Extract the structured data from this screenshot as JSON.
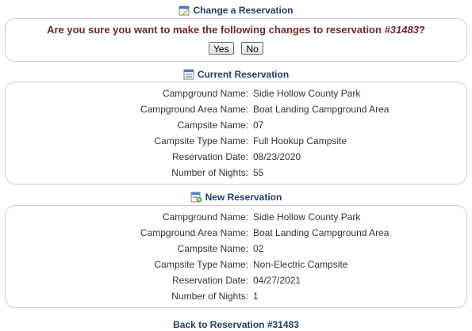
{
  "change": {
    "title": "Change a Reservation",
    "question_prefix": "Are you sure you want to make the following changes to reservation ",
    "reservation_number": "#31483",
    "question_suffix": "?",
    "yes_label": "Yes",
    "no_label": "No"
  },
  "current": {
    "title": "Current Reservation",
    "fields": [
      {
        "label": "Campground Name:",
        "value": "Sidie Hollow County Park"
      },
      {
        "label": "Campground Area Name:",
        "value": "Boat Landing Campground Area"
      },
      {
        "label": "Campsite Name:",
        "value": "07"
      },
      {
        "label": "Campsite Type Name:",
        "value": "Full Hookup Campsite"
      },
      {
        "label": "Reservation Date:",
        "value": "08/23/2020"
      },
      {
        "label": "Number of Nights:",
        "value": "55"
      }
    ]
  },
  "new": {
    "title": "New Reservation",
    "fields": [
      {
        "label": "Campground Name:",
        "value": "Sidie Hollow County Park"
      },
      {
        "label": "Campground Area Name:",
        "value": "Boat Landing Campground Area"
      },
      {
        "label": "Campsite Name:",
        "value": "02"
      },
      {
        "label": "Campsite Type Name:",
        "value": "Non-Electric Campsite"
      },
      {
        "label": "Reservation Date:",
        "value": "04/27/2021"
      },
      {
        "label": "Number of Nights:",
        "value": "1"
      }
    ]
  },
  "back_link": "Back to Reservation #31483",
  "icons": {
    "change": "calendar-edit-icon",
    "current": "form-list-icon",
    "new": "form-add-icon"
  },
  "colors": {
    "header_text": "#1f3f66",
    "confirm_text": "#6b2a2a",
    "box_border": "#c9ced6"
  }
}
